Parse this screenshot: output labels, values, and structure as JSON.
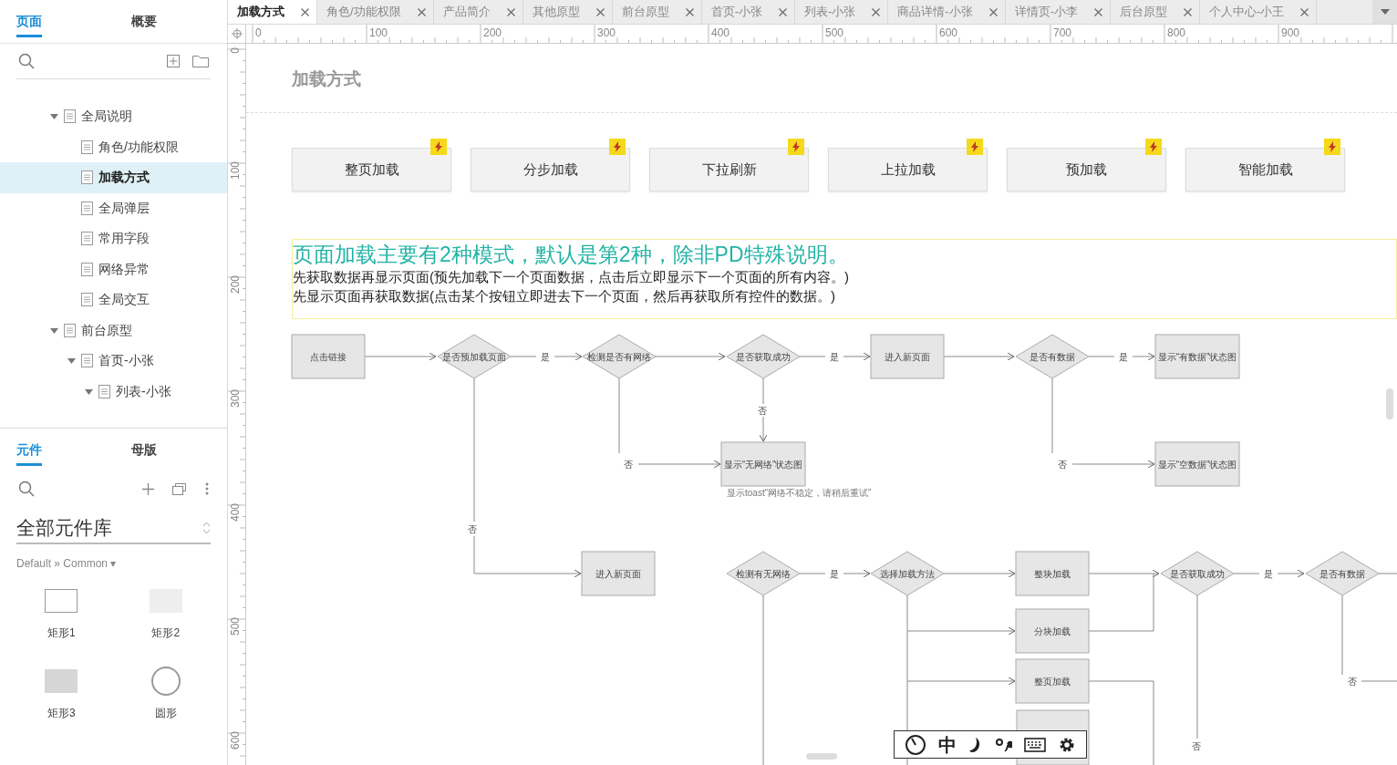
{
  "sidebar": {
    "tabs": [
      {
        "label": "页面",
        "selected": true
      },
      {
        "label": "概要",
        "selected": false
      }
    ],
    "tree": [
      {
        "label": "全局说明",
        "expanded": true,
        "selected": false,
        "children": [
          {
            "label": "角色/功能权限",
            "selected": false
          },
          {
            "label": "加载方式",
            "selected": true
          },
          {
            "label": "全局弹层",
            "selected": false
          },
          {
            "label": "常用字段",
            "selected": false
          },
          {
            "label": "网络异常",
            "selected": false
          },
          {
            "label": "全局交互",
            "selected": false
          }
        ]
      },
      {
        "label": "前台原型",
        "expanded": true,
        "selected": false,
        "children": [
          {
            "label": "首页-小张",
            "expanded": true,
            "selected": false,
            "children": [
              {
                "label": "列表-小张",
                "expanded": true,
                "selected": false
              }
            ]
          }
        ]
      }
    ]
  },
  "library": {
    "tabs": [
      {
        "label": "元件",
        "selected": true
      },
      {
        "label": "母版",
        "selected": false
      }
    ],
    "title": "全部元件库",
    "filter": "Default » Common ▾",
    "widgets": [
      {
        "kind": "rect",
        "label": "矩形1"
      },
      {
        "kind": "rect-light",
        "label": "矩形2"
      },
      {
        "kind": "rect-filled",
        "label": "矩形3"
      },
      {
        "kind": "circle",
        "label": "圆形"
      }
    ]
  },
  "tabs": [
    {
      "label": "加载方式",
      "selected": true
    },
    {
      "label": "角色/功能权限",
      "selected": false
    },
    {
      "label": "产品简介",
      "selected": false
    },
    {
      "label": "其他原型",
      "selected": false
    },
    {
      "label": "前台原型",
      "selected": false
    },
    {
      "label": "首页-小张",
      "selected": false
    },
    {
      "label": "列表-小张",
      "selected": false
    },
    {
      "label": "商品详情-小张",
      "selected": false
    },
    {
      "label": "详情页-小李",
      "selected": false
    },
    {
      "label": "后台原型",
      "selected": false
    },
    {
      "label": "个人中心-小王",
      "selected": false
    }
  ],
  "ruler": {
    "x_labels": [
      "0",
      "100",
      "200",
      "300",
      "400",
      "500",
      "600",
      "700",
      "800",
      "900"
    ],
    "y_labels": [
      "0",
      "100",
      "200",
      "300",
      "400",
      "500",
      "600"
    ]
  },
  "page": {
    "title": "加载方式",
    "buttons": [
      "整页加载",
      "分步加载",
      "下拉刷新",
      "上拉加载",
      "预加载",
      "智能加载"
    ],
    "heading": "页面加载主要有2种模式，默认是第2种，除非PD特殊说明。",
    "lines": [
      "先获取数据再显示页面(预先加载下一个页面数据，点击后立即显示下一个页面的所有内容。)",
      "先显示页面再获取数据(点击某个按钮立即进去下一个页面，然后再获取所有控件的数据。)"
    ]
  },
  "flowchart": {
    "nodes": [
      {
        "kind": "rect",
        "text": "点击链接"
      },
      {
        "kind": "diamond",
        "text": "是否预加载页面"
      },
      {
        "kind": "label",
        "text": "是"
      },
      {
        "kind": "diamond",
        "text": "检测是否有网络"
      },
      {
        "kind": "diamond",
        "text": "是否获取成功"
      },
      {
        "kind": "label",
        "text": "是"
      },
      {
        "kind": "rect",
        "text": "进入新页面"
      },
      {
        "kind": "diamond",
        "text": "是否有数据"
      },
      {
        "kind": "label",
        "text": "是"
      },
      {
        "kind": "rect",
        "text": "显示“有数据”状态图"
      },
      {
        "kind": "label",
        "text": "否"
      },
      {
        "kind": "label",
        "text": "否"
      },
      {
        "kind": "rect",
        "text": "显示“无网络”状态图"
      },
      {
        "kind": "caption",
        "text": "显示toast“网络不稳定，请稍后重试”"
      },
      {
        "kind": "label",
        "text": "否"
      },
      {
        "kind": "rect",
        "text": "显示“空数据”状态图"
      },
      {
        "kind": "label",
        "text": "否"
      },
      {
        "kind": "rect",
        "text": "进入新页面"
      },
      {
        "kind": "diamond",
        "text": "检测有无网络"
      },
      {
        "kind": "label",
        "text": "是"
      },
      {
        "kind": "diamond",
        "text": "选择加载方法"
      },
      {
        "kind": "rect",
        "text": "整块加载"
      },
      {
        "kind": "rect",
        "text": "分块加载"
      },
      {
        "kind": "rect",
        "text": "整页加载"
      },
      {
        "kind": "diamond",
        "text": "是否获取成功"
      },
      {
        "kind": "label",
        "text": "是"
      },
      {
        "kind": "diamond",
        "text": "是否有数据"
      },
      {
        "kind": "label",
        "text": "否"
      },
      {
        "kind": "label",
        "text": "否"
      }
    ]
  },
  "ime_toolbar": {
    "mode": "中"
  }
}
